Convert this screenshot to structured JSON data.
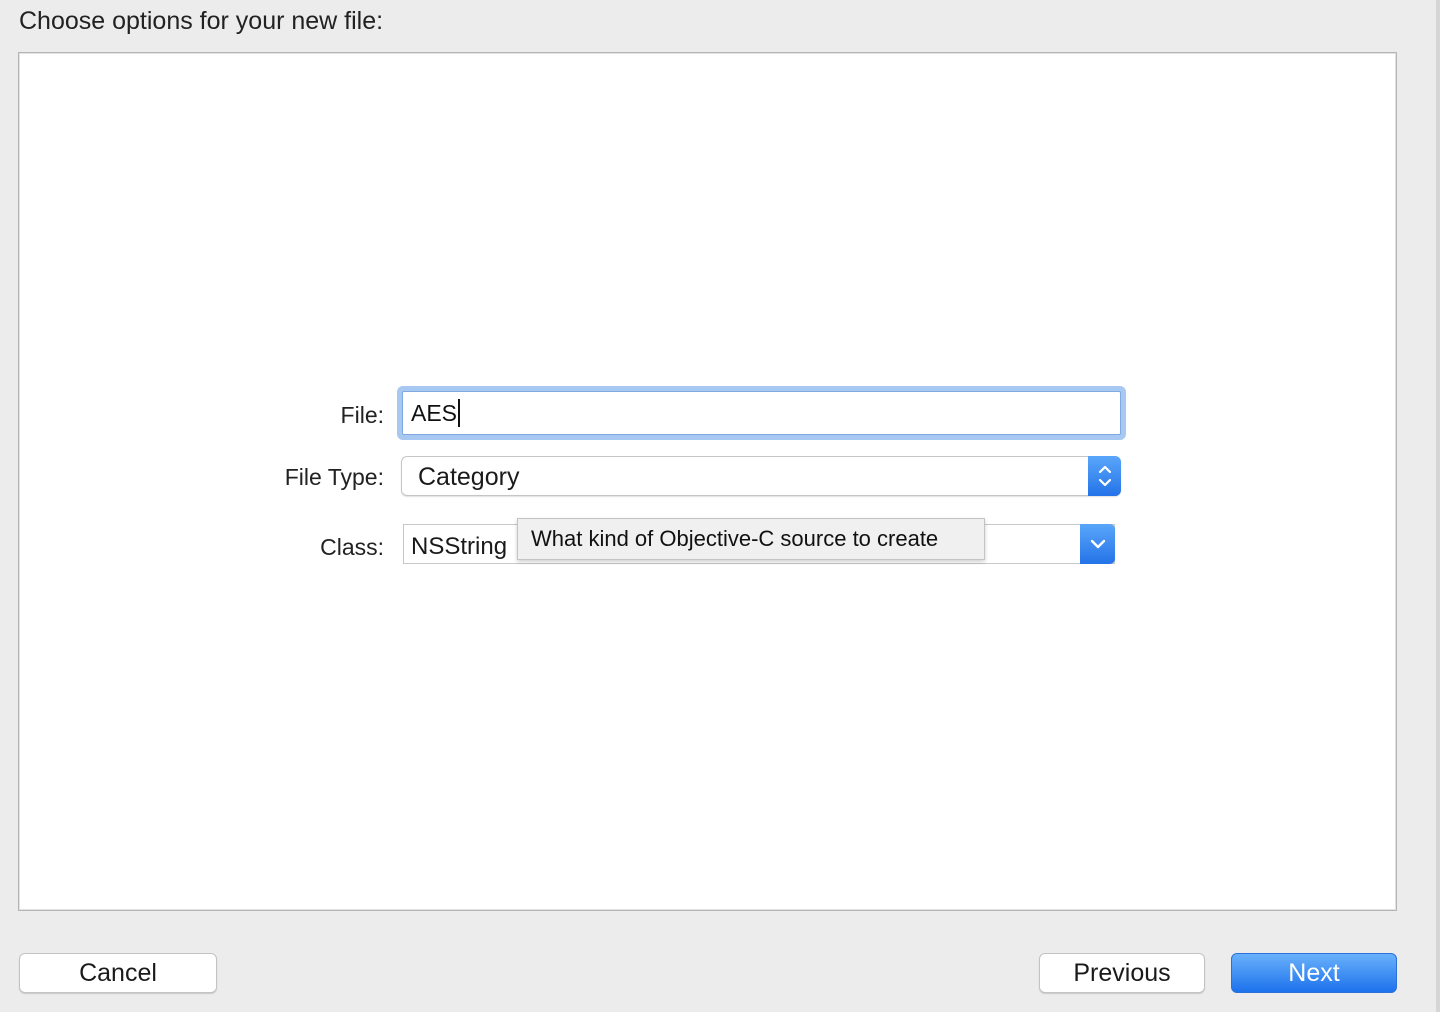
{
  "dialog": {
    "heading": "Choose options for your new file:"
  },
  "form": {
    "file": {
      "label": "File:",
      "value": "AES"
    },
    "file_type": {
      "label": "File Type:",
      "value": "Category",
      "icon": "up-down-chevron-icon"
    },
    "class": {
      "label": "Class:",
      "value": "NSString",
      "icon": "chevron-down-icon"
    }
  },
  "tooltip": {
    "text": "What kind of Objective-C source to create"
  },
  "buttons": {
    "cancel": "Cancel",
    "previous": "Previous",
    "next": "Next"
  },
  "colors": {
    "accent": "#2473e8",
    "focus_ring": "#a6c8f1",
    "window_background": "#ececec"
  }
}
